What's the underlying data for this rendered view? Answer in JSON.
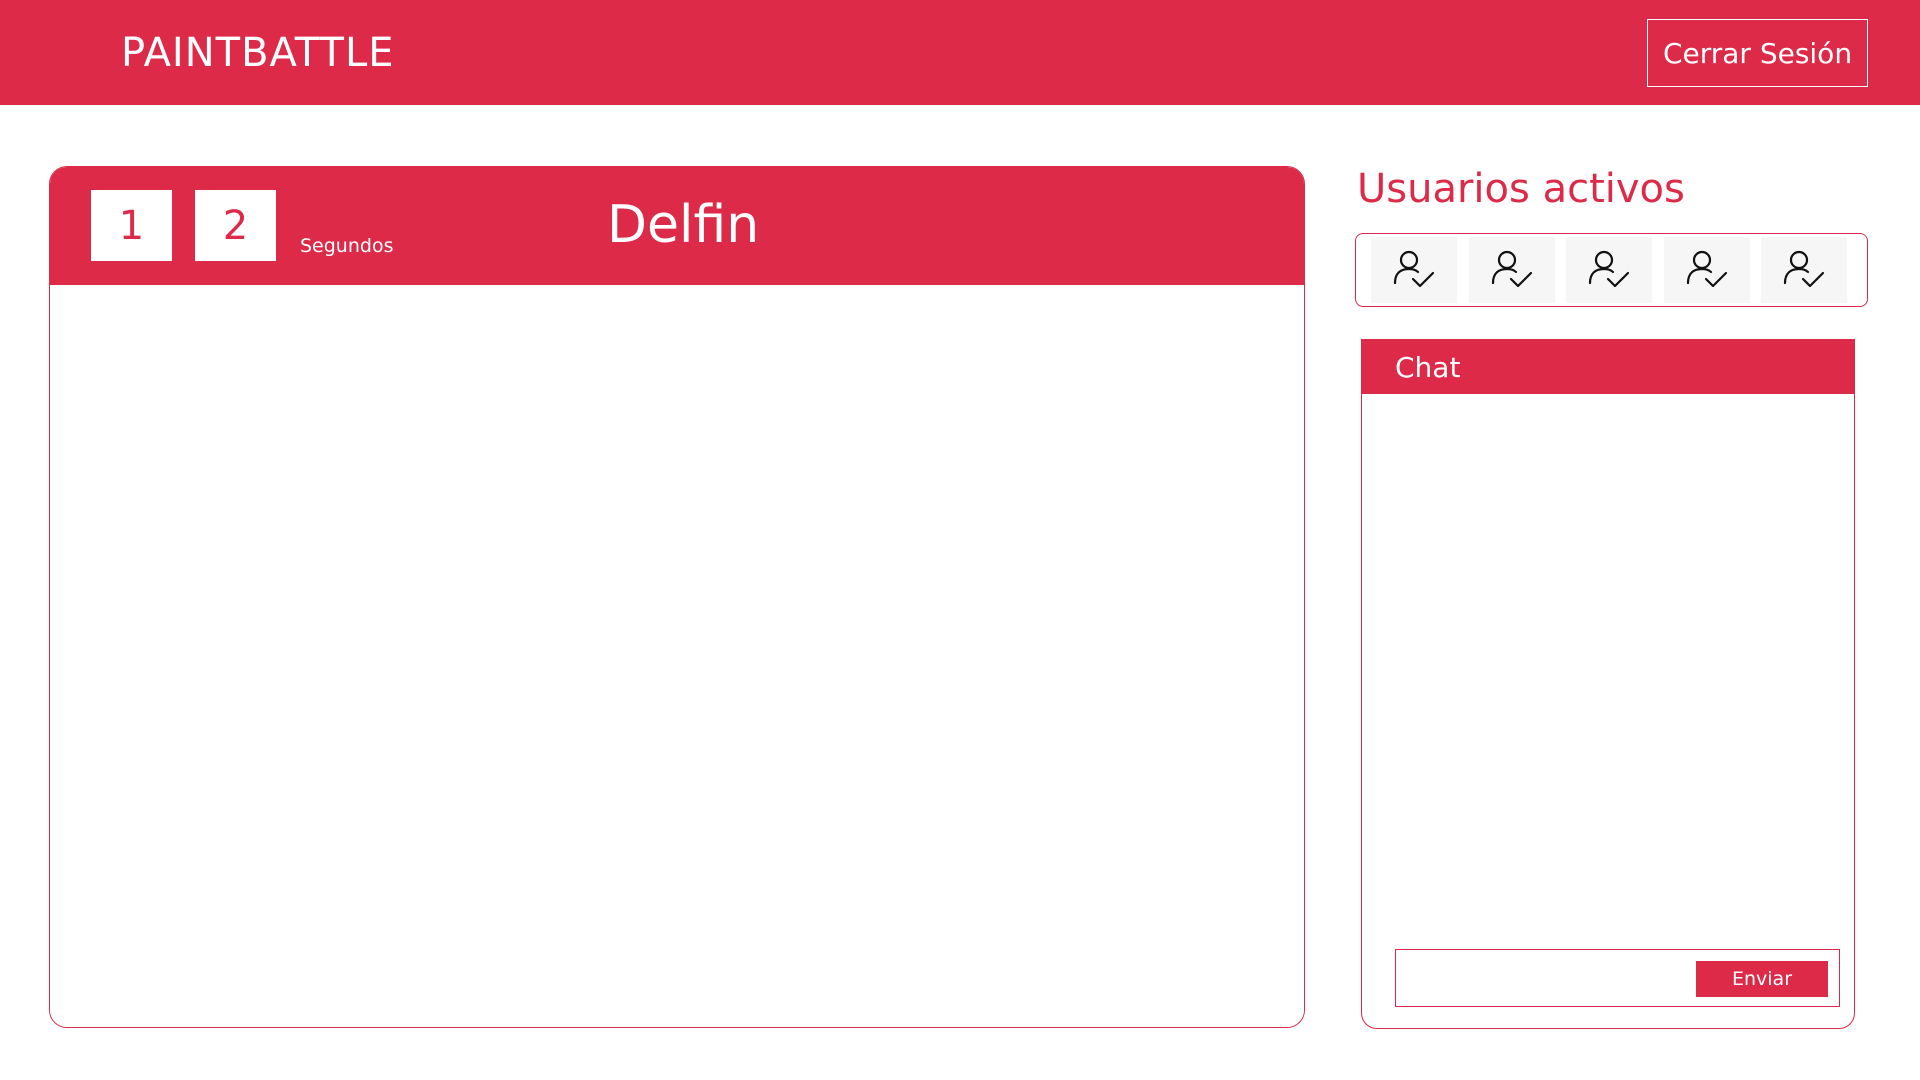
{
  "app": {
    "brand": "PAINTBATTLE",
    "logout_label": "Cerrar Sesión"
  },
  "game": {
    "timer_digits": [
      "1",
      "2"
    ],
    "timer_unit": "Segundos",
    "word": "Delfin"
  },
  "users": {
    "title": "Usuarios activos",
    "icons": [
      "user-check-icon",
      "user-check-icon",
      "user-check-icon",
      "user-check-icon",
      "user-check-icon"
    ]
  },
  "chat": {
    "title": "Chat",
    "input_value": "",
    "send_label": "Enviar"
  },
  "colors": {
    "accent": "#dc2a48",
    "background": "#ffffff"
  }
}
